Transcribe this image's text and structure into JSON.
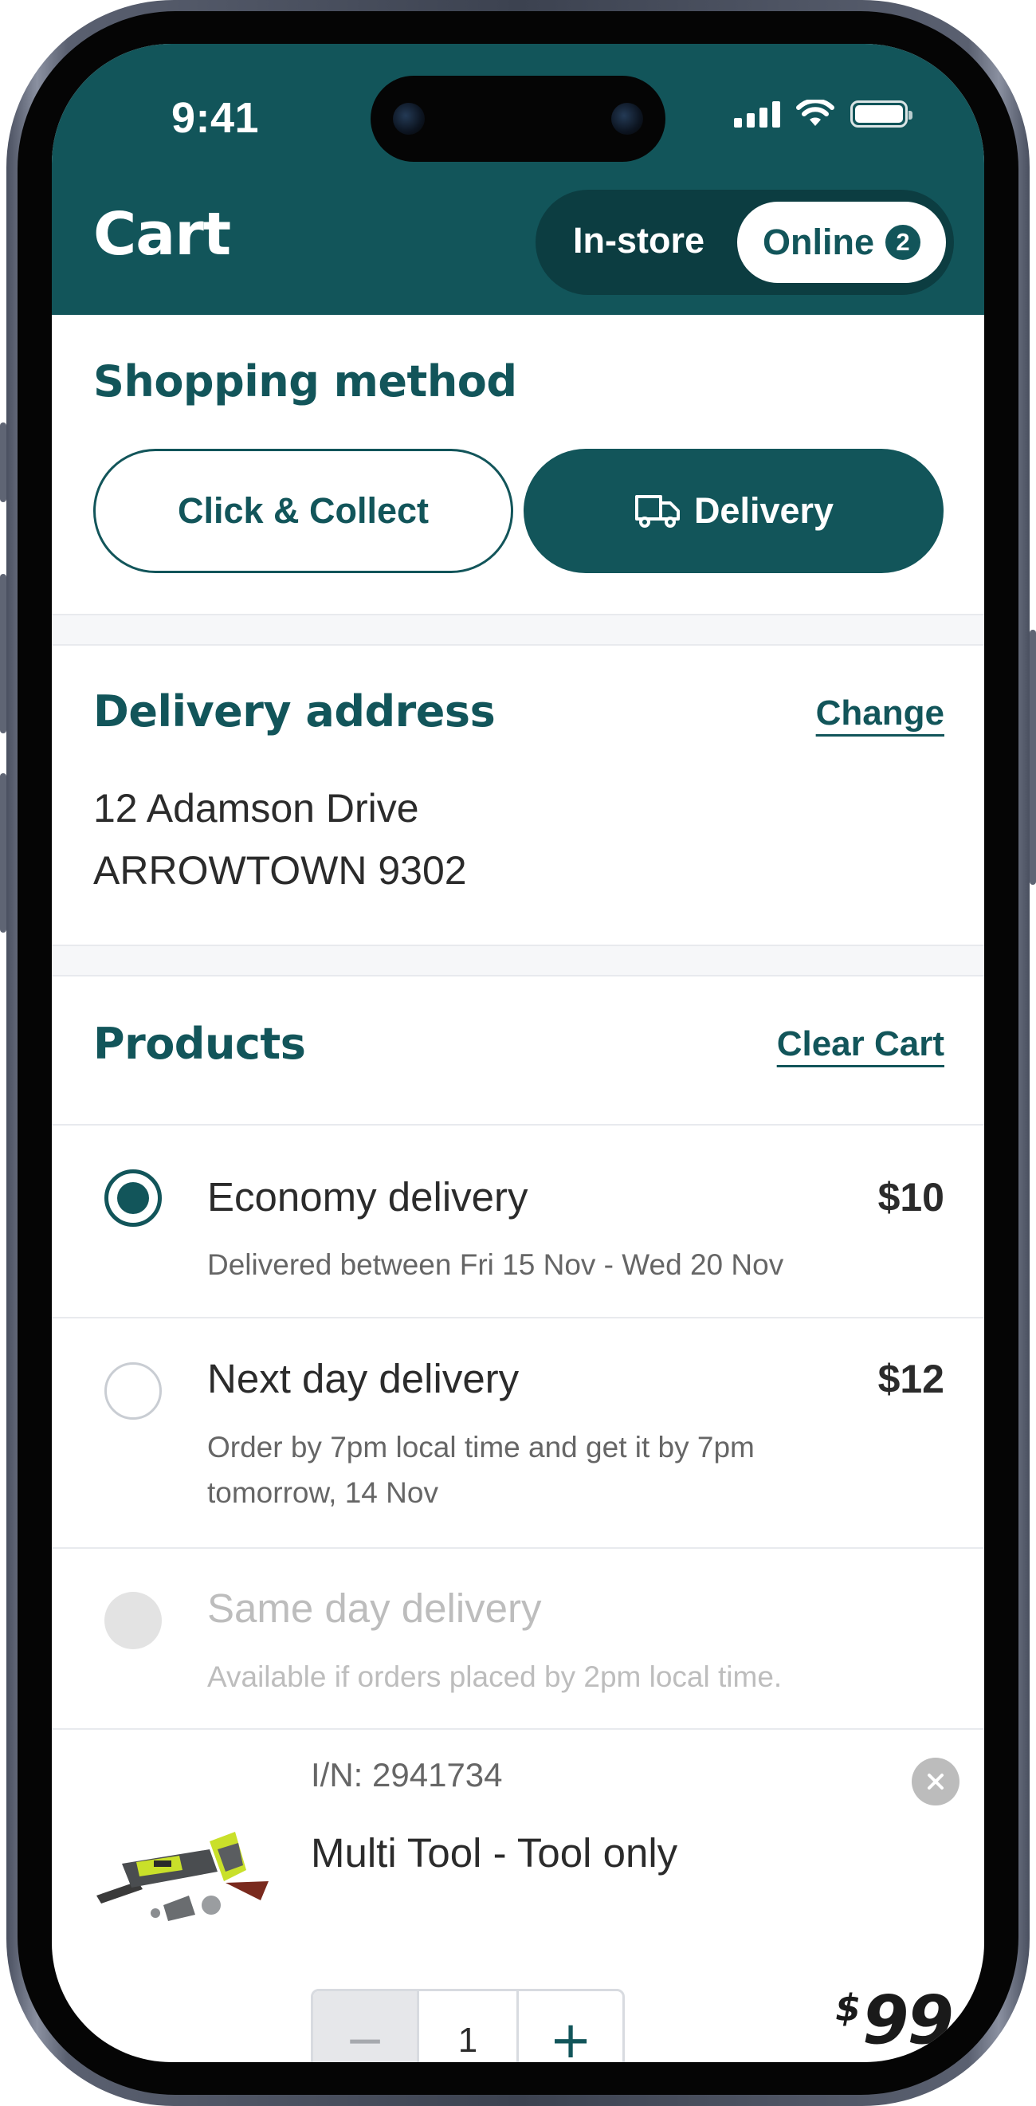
{
  "status_bar": {
    "time": "9:41"
  },
  "header": {
    "title": "Cart",
    "toggle": {
      "instore_label": "In-store",
      "online_label": "Online",
      "online_count": "2",
      "selected": "Online"
    }
  },
  "shopping_method": {
    "title": "Shopping method",
    "click_collect_label": "Click & Collect",
    "delivery_label": "Delivery",
    "selected": "Delivery"
  },
  "delivery_address": {
    "title": "Delivery address",
    "change_label": "Change",
    "line1": "12 Adamson Drive",
    "line2": "ARROWTOWN 9302"
  },
  "products": {
    "title": "Products",
    "clear_label": "Clear Cart",
    "options": [
      {
        "title": "Economy delivery",
        "price": "$10",
        "desc": "Delivered between Fri 15 Nov - Wed 20 Nov",
        "selected": true,
        "disabled": false
      },
      {
        "title": "Next day delivery",
        "price": "$12",
        "desc": "Order by 7pm local time and get it by 7pm tomorrow, 14 Nov",
        "selected": false,
        "disabled": false
      },
      {
        "title": "Same day delivery",
        "price": "",
        "desc": "Available if orders placed by 2pm local time.",
        "selected": false,
        "disabled": true
      }
    ],
    "item": {
      "in_label": "I/N: 2941734",
      "name": "Multi Tool - Tool only",
      "quantity": "1",
      "price_symbol": "$",
      "price_value": "99"
    }
  },
  "colors": {
    "brand": "#12555a",
    "brand_dark": "#0c3d41",
    "accent_tool": "#c9e02a"
  },
  "icons": [
    "signal-icon",
    "wifi-icon",
    "battery-icon",
    "truck-icon",
    "close-icon",
    "minus-icon",
    "plus-icon"
  ]
}
